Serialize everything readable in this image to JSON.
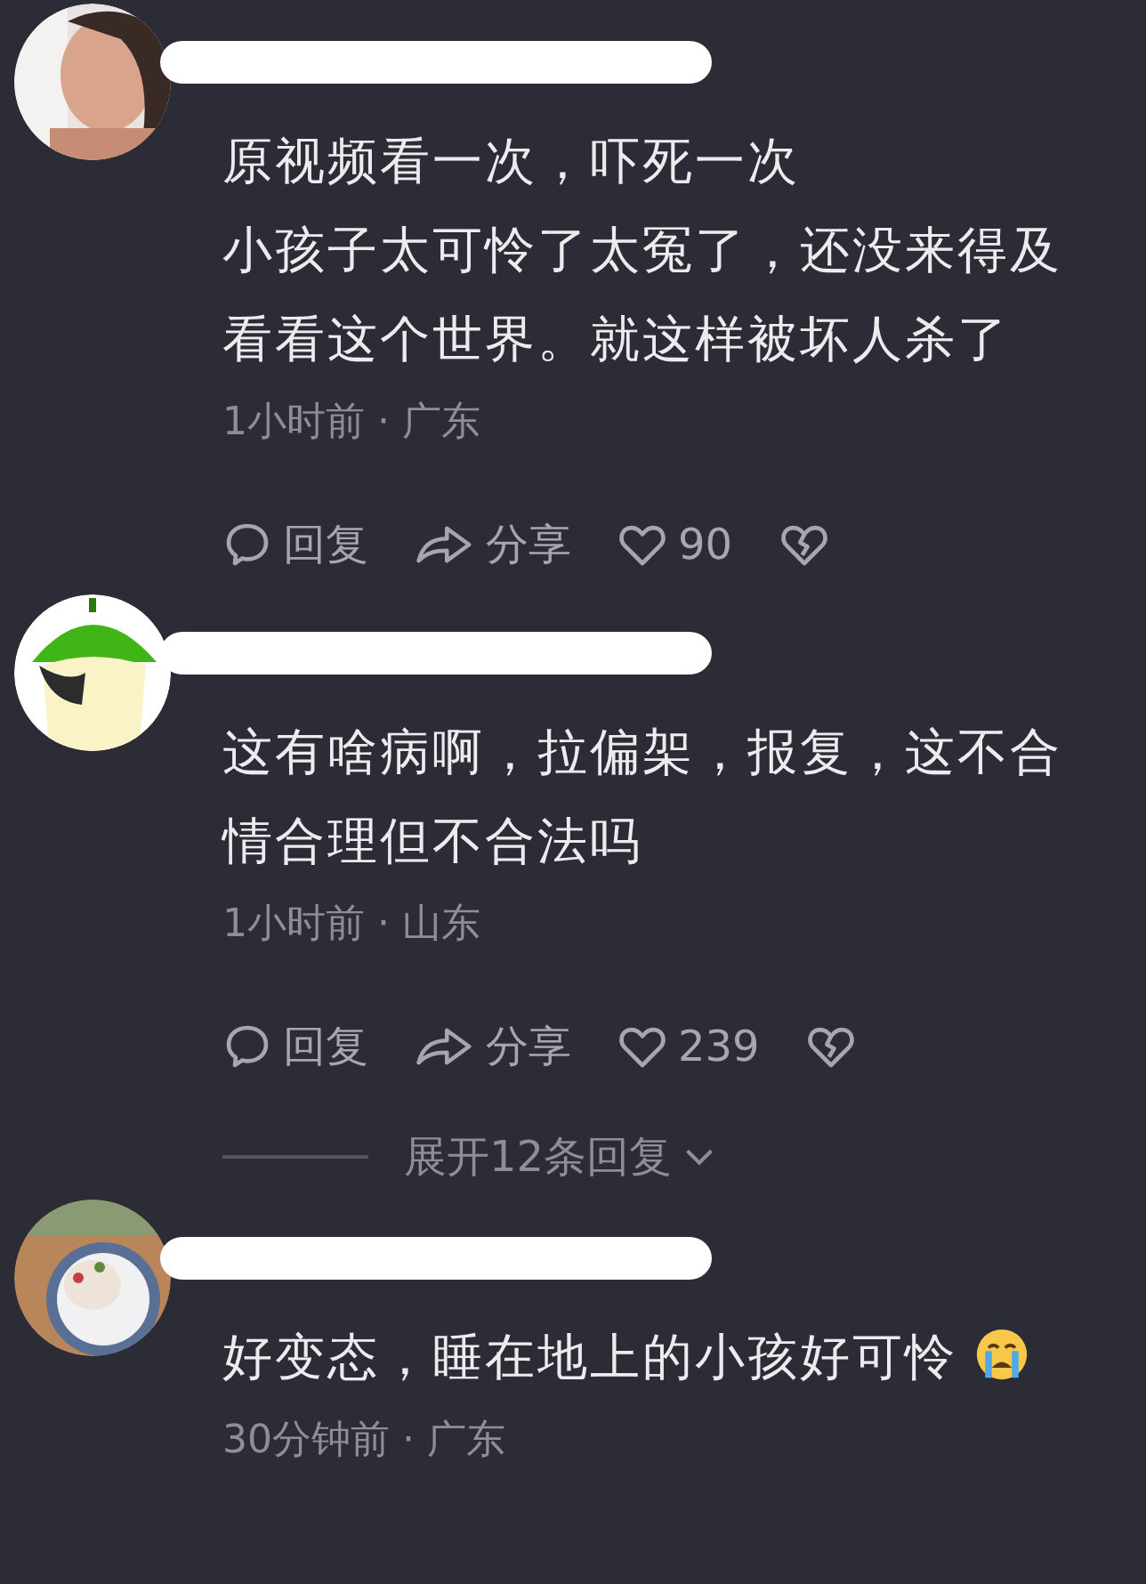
{
  "comments": [
    {
      "avatar": {
        "kind": "picture"
      },
      "lines": [
        "原视频看一次，吓死一次",
        "小孩子太可怜了太冤了，还没来得及看看这个世界。就这样被坏人杀了"
      ],
      "meta": "1小时前 · 广东",
      "actions": {
        "reply": "回复",
        "share": "分享",
        "likes": "90"
      }
    },
    {
      "avatar": {
        "kind": "picture"
      },
      "lines": [
        "这有啥病啊，拉偏架，报复，这不合情合理但不合法吗"
      ],
      "meta": "1小时前 · 山东",
      "actions": {
        "reply": "回复",
        "share": "分享",
        "likes": "239"
      },
      "replies_toggle": "展开12条回复"
    },
    {
      "avatar": {
        "kind": "picture"
      },
      "lines": [
        "好变态，睡在地上的小孩好可怜"
      ],
      "trailing_emoji": true,
      "meta": "30分钟前 · 广东"
    }
  ]
}
